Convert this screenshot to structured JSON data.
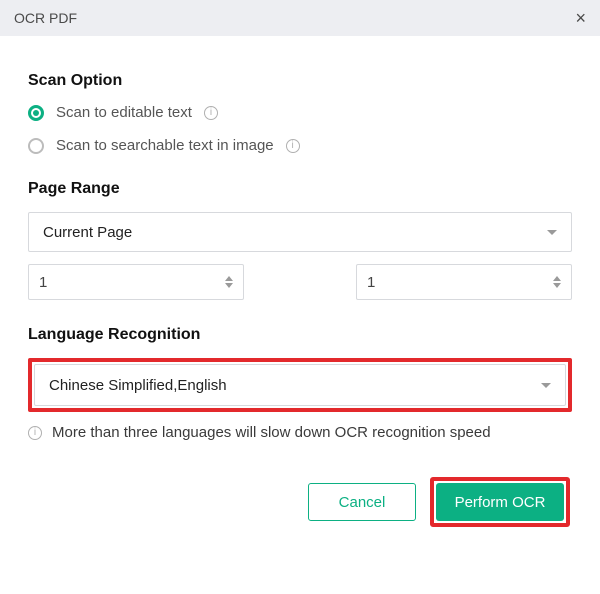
{
  "dialog": {
    "title": "OCR PDF"
  },
  "scan": {
    "heading": "Scan Option",
    "opt1": "Scan to editable text",
    "opt2": "Scan to searchable text in image"
  },
  "range": {
    "heading": "Page Range",
    "select_value": "Current Page",
    "from": "1",
    "to": "1"
  },
  "lang": {
    "heading": "Language Recognition",
    "value": "Chinese Simplified,English",
    "warning": "More than three languages will slow down OCR recognition speed"
  },
  "buttons": {
    "cancel": "Cancel",
    "perform": "Perform OCR"
  }
}
